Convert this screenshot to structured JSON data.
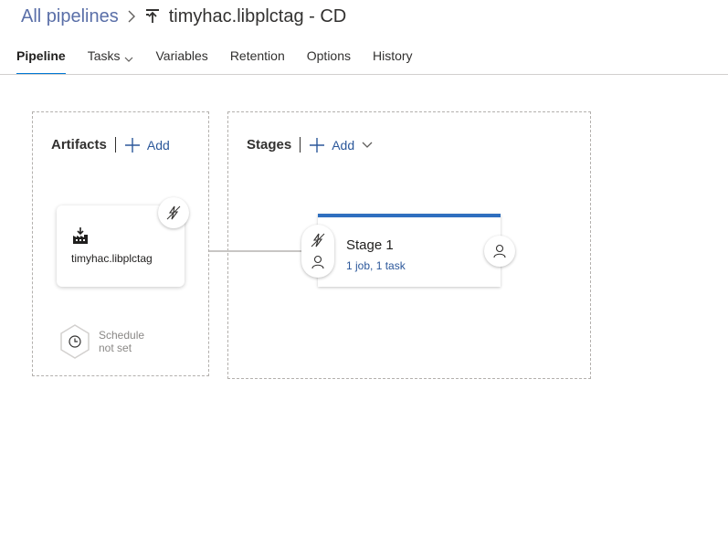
{
  "breadcrumb": {
    "root": "All pipelines",
    "title": "timyhac.libplctag - CD"
  },
  "tabs": [
    {
      "label": "Pipeline",
      "active": true
    },
    {
      "label": "Tasks",
      "has_dropdown": true
    },
    {
      "label": "Variables"
    },
    {
      "label": "Retention"
    },
    {
      "label": "Options"
    },
    {
      "label": "History"
    }
  ],
  "artifacts": {
    "title": "Artifacts",
    "add_label": "Add",
    "items": [
      {
        "name": "timyhac.libplctag",
        "icon": "build-artifact-icon"
      }
    ],
    "schedule": {
      "line1": "Schedule",
      "line2": "not set"
    }
  },
  "stages": {
    "title": "Stages",
    "add_label": "Add",
    "items": [
      {
        "name": "Stage 1",
        "tasks": "1 job, 1 task"
      }
    ]
  },
  "colors": {
    "accent": "#0078d4",
    "link": "#2b579a",
    "stage_bar": "#2f6fbf",
    "breadcrumb_link": "#5a6fa8"
  }
}
